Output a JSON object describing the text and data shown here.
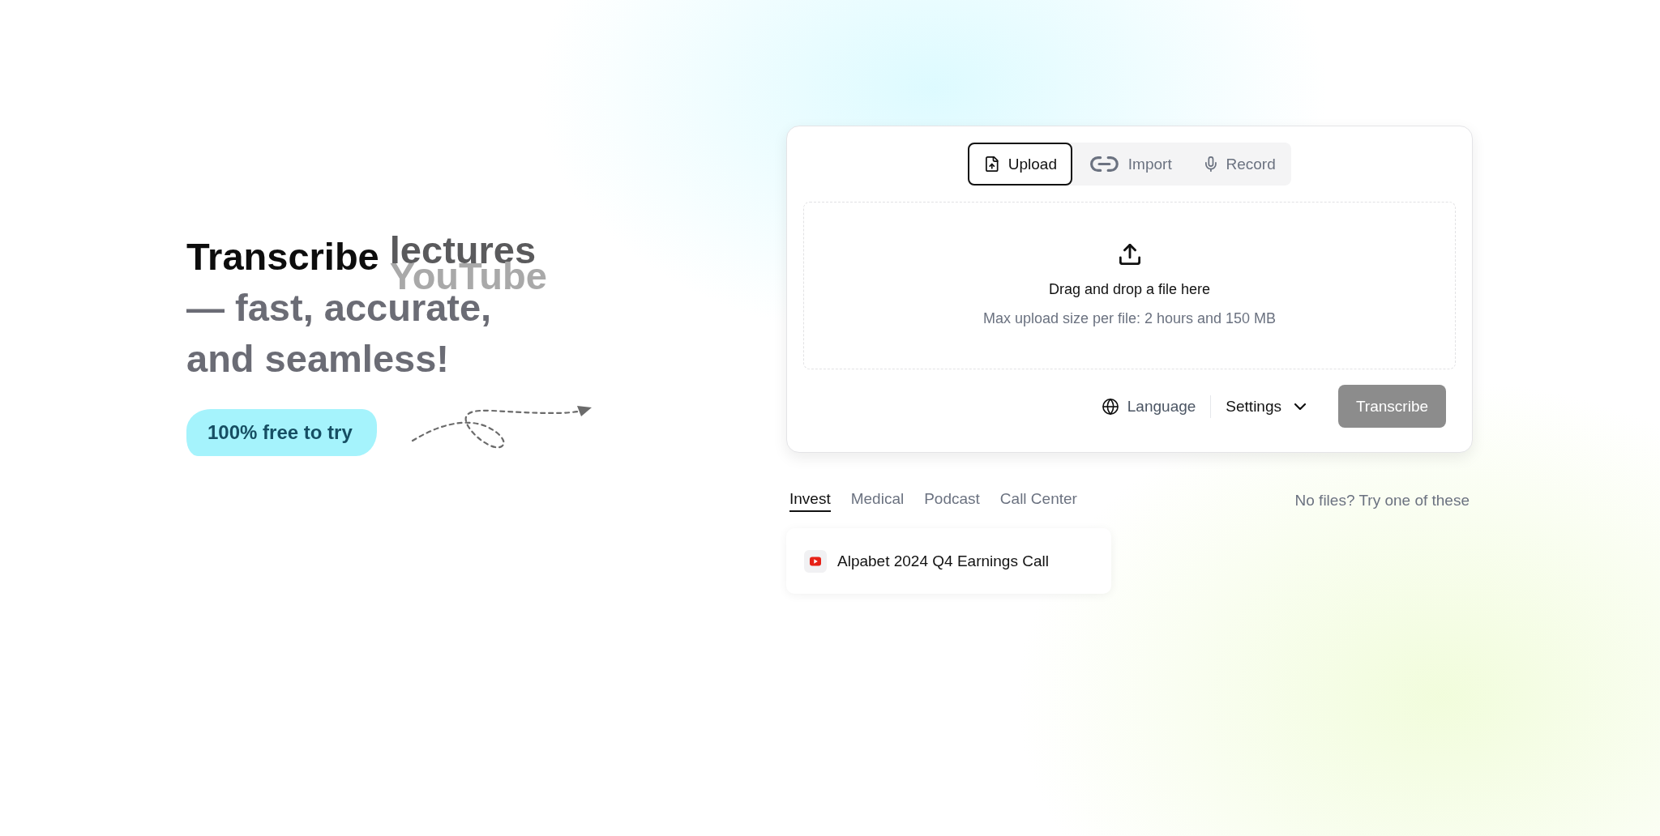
{
  "hero": {
    "heading": {
      "lead": "Transcribe",
      "rotating_words": [
        {
          "text": "lectures",
          "kind": "outgoing"
        },
        {
          "text": "YouTube",
          "kind": "incoming"
        }
      ],
      "tail": "— fast, accurate, and seamless!"
    },
    "badge": "100% free to try"
  },
  "upload_card": {
    "tabs": [
      {
        "label": "Upload",
        "kind": "upload",
        "selected": true
      },
      {
        "label": "Import",
        "kind": "import",
        "selected": false
      },
      {
        "label": "Record",
        "kind": "record",
        "selected": false
      }
    ],
    "dropzone": {
      "title": "Drag and drop a file here",
      "hint": "Max upload size per file: 2 hours and 150 MB"
    },
    "language_button": "Language",
    "settings_button": "Settings",
    "transcribe_button": {
      "label": "Transcribe",
      "disabled": true
    }
  },
  "samples": {
    "categories": [
      {
        "label": "Invest",
        "selected": true
      },
      {
        "label": "Medical",
        "selected": false
      },
      {
        "label": "Podcast",
        "selected": false
      },
      {
        "label": "Call Center",
        "selected": false
      }
    ],
    "hint": "No files? Try one of these",
    "items": [
      {
        "title": "Alpabet 2024 Q4 Earnings Call"
      }
    ]
  }
}
